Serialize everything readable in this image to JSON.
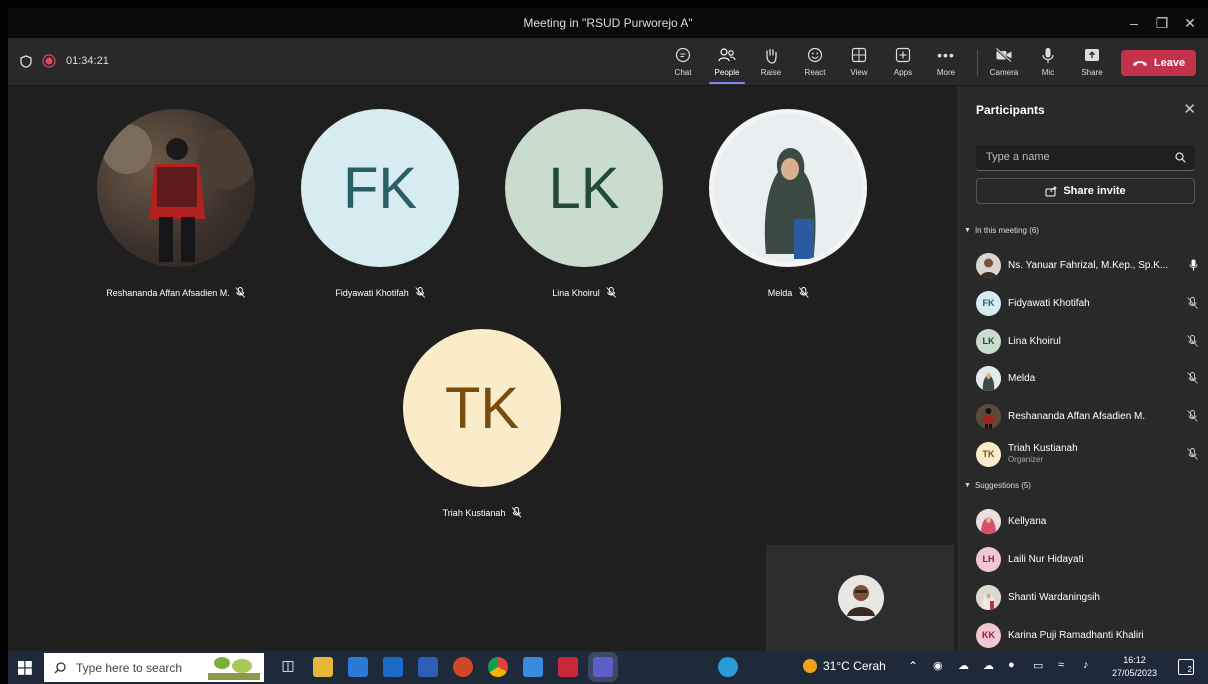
{
  "window": {
    "title": "Meeting in \"RSUD Purworejo A\""
  },
  "toolbar": {
    "timer": "01:34:21",
    "buttons": {
      "chat": "Chat",
      "people": "People",
      "raise": "Raise",
      "react": "React",
      "view": "View",
      "apps": "Apps",
      "more": "More",
      "camera": "Camera",
      "mic": "Mic",
      "share": "Share"
    },
    "leave": "Leave",
    "accent": "#7f85f5",
    "leave_color": "#c4314b"
  },
  "stage": {
    "tiles": [
      {
        "name": "Reshananda Affan Afsadien M.",
        "initials": "",
        "bg": "#5a4a3a"
      },
      {
        "name": "Fidyawati Khotifah",
        "initials": "FK",
        "bg": "#d6ecf0",
        "fg": "#2b5f66"
      },
      {
        "name": "Lina Khoirul",
        "initials": "LK",
        "bg": "#c9dccd",
        "fg": "#224a36"
      },
      {
        "name": "Melda",
        "initials": "",
        "bg": "#e8eef2"
      },
      {
        "name": "Triah Kustianah",
        "initials": "TK",
        "bg": "#faecc8",
        "fg": "#7a4d0e"
      }
    ]
  },
  "panel": {
    "title": "Participants",
    "search_placeholder": "Type a name",
    "share_invite": "Share invite",
    "in_meeting_label": "In this meeting (6)",
    "suggestions_label": "Suggestions (5)",
    "in_meeting": [
      {
        "name": "Ns. Yanuar Fahrizal, M.Kep., Sp.K...",
        "initials": "",
        "bg": "#8a6a50",
        "mic": "on"
      },
      {
        "name": "Fidyawati Khotifah",
        "initials": "FK",
        "bg": "#d6ecf0",
        "fg": "#2b5f66",
        "mic": "off"
      },
      {
        "name": "Lina Khoirul",
        "initials": "LK",
        "bg": "#c9dccd",
        "fg": "#224a36",
        "mic": "off"
      },
      {
        "name": "Melda",
        "initials": "",
        "bg": "#d8dee4",
        "mic": "off"
      },
      {
        "name": "Reshananda Affan Afsadien M.",
        "initials": "",
        "bg": "#5a4a3a",
        "mic": "off"
      },
      {
        "name": "Triah Kustianah",
        "sub": "Organizer",
        "initials": "TK",
        "bg": "#faecc8",
        "fg": "#7a4d0e",
        "mic": "off"
      }
    ],
    "suggestions": [
      {
        "name": "Kellyana",
        "initials": "",
        "bg": "#d86a7a"
      },
      {
        "name": "Laili Nur Hidayati",
        "initials": "LH",
        "bg": "#f2c6d0",
        "fg": "#8a2040"
      },
      {
        "name": "Shanti Wardaningsih",
        "initials": "",
        "bg": "#c9c2b8"
      },
      {
        "name": "Karina Puji Ramadhanti Khaliri",
        "initials": "KK",
        "bg": "#f2c6d0",
        "fg": "#8a2040"
      }
    ]
  },
  "taskbar": {
    "search_placeholder": "Type here to search",
    "weather": "31°C Cerah",
    "time": "16:12",
    "date": "27/05/2023",
    "notifications": "2"
  }
}
